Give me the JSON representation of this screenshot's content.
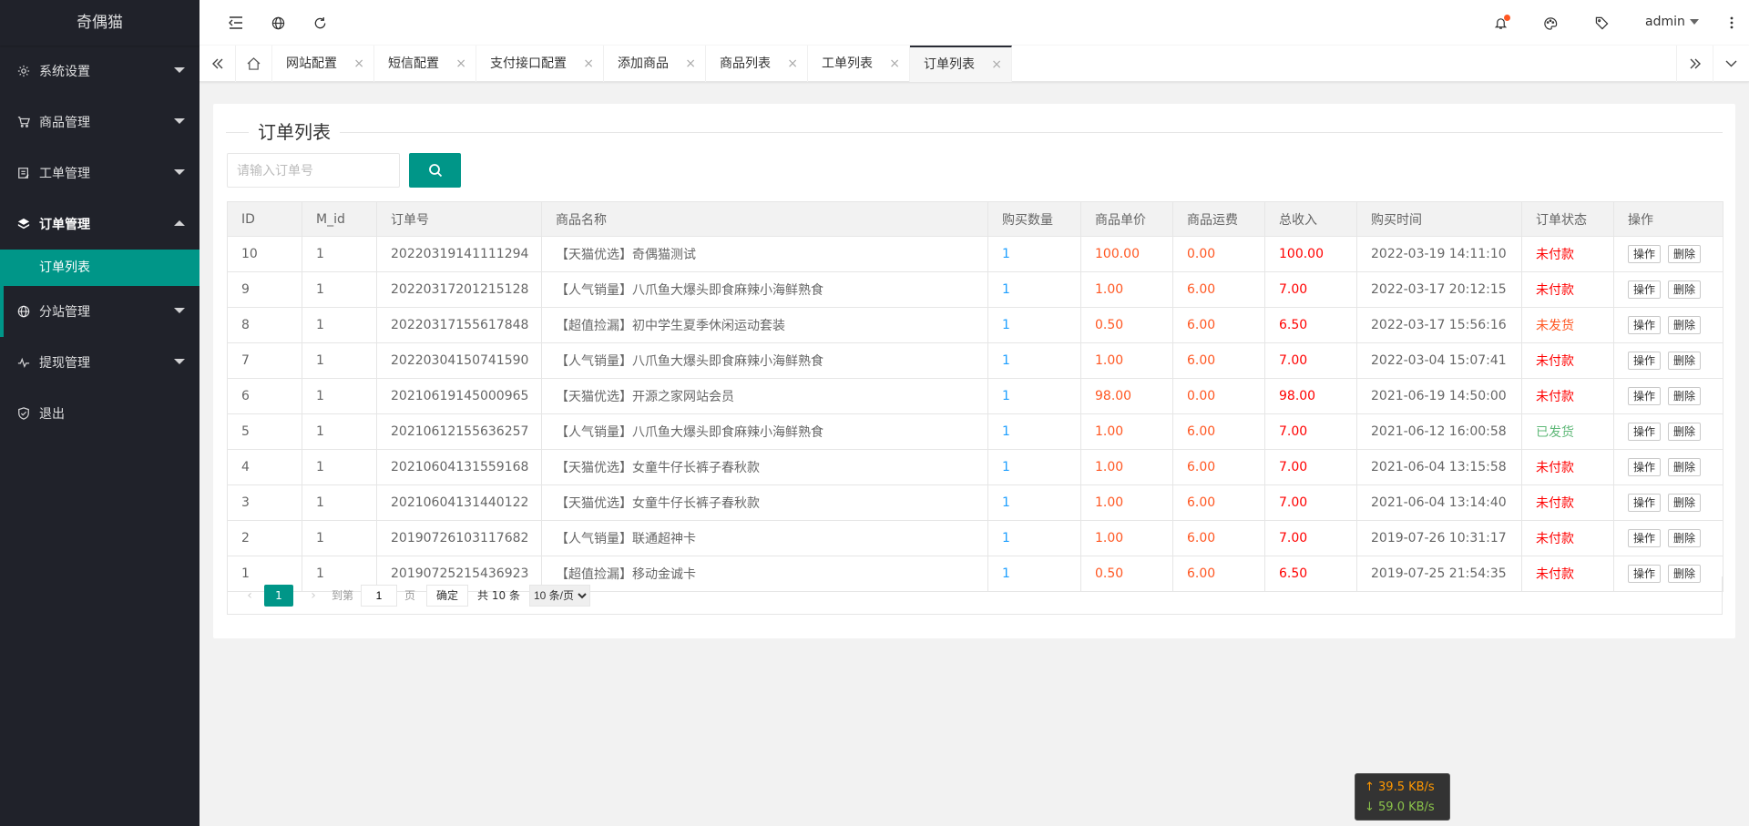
{
  "app": {
    "logo": "奇偶猫"
  },
  "sidebar": {
    "items": [
      {
        "label": "系统设置",
        "icon": "gear-icon"
      },
      {
        "label": "商品管理",
        "icon": "cart-icon"
      },
      {
        "label": "工单管理",
        "icon": "ticket-icon"
      },
      {
        "label": "订单管理",
        "icon": "layers-icon"
      },
      {
        "label": "分站管理",
        "icon": "globe-icon"
      },
      {
        "label": "提现管理",
        "icon": "pulse-icon"
      },
      {
        "label": "退出",
        "icon": "shield-icon"
      }
    ],
    "sub_active": "订单列表"
  },
  "header": {
    "user": "admin"
  },
  "tabs": [
    {
      "label": "网站配置"
    },
    {
      "label": "短信配置"
    },
    {
      "label": "支付接口配置"
    },
    {
      "label": "添加商品"
    },
    {
      "label": "商品列表"
    },
    {
      "label": "工单列表"
    },
    {
      "label": "订单列表"
    }
  ],
  "tab_close": "×",
  "page": {
    "title": "订单列表",
    "search_placeholder": "请输入订单号"
  },
  "table": {
    "headers": [
      "ID",
      "M_id",
      "订单号",
      "商品名称",
      "购买数量",
      "商品单价",
      "商品运费",
      "总收入",
      "购买时间",
      "订单状态",
      "操作"
    ],
    "action_op": "操作",
    "action_del": "删除",
    "rows": [
      {
        "id": "10",
        "mid": "1",
        "order": "20220319141111294",
        "name": "【天猫优选】奇偶猫测试",
        "qty": "1",
        "price": "100.00",
        "ship": "0.00",
        "total": "100.00",
        "time": "2022-03-19 14:11:10",
        "status": "未付款"
      },
      {
        "id": "9",
        "mid": "1",
        "order": "20220317201215128",
        "name": "【人气销量】八爪鱼大爆头即食麻辣小海鲜熟食",
        "qty": "1",
        "price": "1.00",
        "ship": "6.00",
        "total": "7.00",
        "time": "2022-03-17 20:12:15",
        "status": "未付款"
      },
      {
        "id": "8",
        "mid": "1",
        "order": "20220317155617848",
        "name": "【超值捡漏】初中学生夏季休闲运动套装",
        "qty": "1",
        "price": "0.50",
        "ship": "6.00",
        "total": "6.50",
        "time": "2022-03-17 15:56:16",
        "status": "未发货"
      },
      {
        "id": "7",
        "mid": "1",
        "order": "20220304150741590",
        "name": "【人气销量】八爪鱼大爆头即食麻辣小海鲜熟食",
        "qty": "1",
        "price": "1.00",
        "ship": "6.00",
        "total": "7.00",
        "time": "2022-03-04 15:07:41",
        "status": "未付款"
      },
      {
        "id": "6",
        "mid": "1",
        "order": "20210619145000965",
        "name": "【天猫优选】开源之家网站会员",
        "qty": "1",
        "price": "98.00",
        "ship": "0.00",
        "total": "98.00",
        "time": "2021-06-19 14:50:00",
        "status": "未付款"
      },
      {
        "id": "5",
        "mid": "1",
        "order": "20210612155636257",
        "name": "【人气销量】八爪鱼大爆头即食麻辣小海鲜熟食",
        "qty": "1",
        "price": "1.00",
        "ship": "6.00",
        "total": "7.00",
        "time": "2021-06-12 16:00:58",
        "status": "已发货"
      },
      {
        "id": "4",
        "mid": "1",
        "order": "20210604131559168",
        "name": "【天猫优选】女童牛仔长裤子春秋款",
        "qty": "1",
        "price": "1.00",
        "ship": "6.00",
        "total": "7.00",
        "time": "2021-06-04 13:15:58",
        "status": "未付款"
      },
      {
        "id": "3",
        "mid": "1",
        "order": "20210604131440122",
        "name": "【天猫优选】女童牛仔长裤子春秋款",
        "qty": "1",
        "price": "1.00",
        "ship": "6.00",
        "total": "7.00",
        "time": "2021-06-04 13:14:40",
        "status": "未付款"
      },
      {
        "id": "2",
        "mid": "1",
        "order": "20190726103117682",
        "name": "【人气销量】联通超神卡",
        "qty": "1",
        "price": "1.00",
        "ship": "6.00",
        "total": "7.00",
        "time": "2019-07-26 10:31:17",
        "status": "未付款"
      },
      {
        "id": "1",
        "mid": "1",
        "order": "20190725215436923",
        "name": "【超值捡漏】移动金诚卡",
        "qty": "1",
        "price": "0.50",
        "ship": "6.00",
        "total": "6.50",
        "time": "2019-07-25 21:54:35",
        "status": "未付款"
      }
    ]
  },
  "pager": {
    "current": "1",
    "goto_prefix": "到第",
    "goto_value": "1",
    "goto_suffix": "页",
    "ok": "确定",
    "count": "共 10 条",
    "per_page": "10 条/页"
  },
  "netspeed": {
    "up": "39.5 KB/s",
    "down": "59.0 KB/s"
  },
  "colors": {
    "accent": "#009688",
    "sidebar": "#20222a",
    "status_unpaid": "#ff0000",
    "status_unshipped": "#ff5722",
    "status_shipped": "#5fb878"
  }
}
